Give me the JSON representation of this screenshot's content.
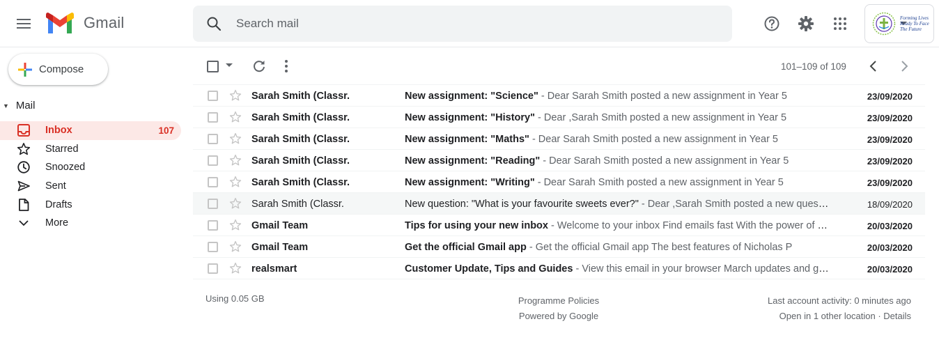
{
  "header": {
    "logo_text": "Gmail",
    "search_placeholder": "Search mail",
    "org_tagline": [
      "Forming Lives",
      "Ready To Face",
      "The Future"
    ]
  },
  "sidebar": {
    "compose_label": "Compose",
    "group_label": "Mail",
    "items": [
      {
        "label": "Inbox",
        "count": "107",
        "icon": "inbox-icon",
        "active": true
      },
      {
        "label": "Starred",
        "count": "",
        "icon": "star-icon",
        "active": false
      },
      {
        "label": "Snoozed",
        "count": "",
        "icon": "clock-icon",
        "active": false
      },
      {
        "label": "Sent",
        "count": "",
        "icon": "send-icon",
        "active": false
      },
      {
        "label": "Drafts",
        "count": "",
        "icon": "draft-icon",
        "active": false
      },
      {
        "label": "More",
        "count": "",
        "icon": "chevron-down-icon",
        "active": false
      }
    ]
  },
  "toolbar": {
    "pager_text": "101–109 of 109"
  },
  "messages": [
    {
      "sender": "Sarah Smith (Classr.",
      "subject": "New assignment: \"Science\"",
      "snippet": " - Dear          Sarah Smith posted a new assignment in Year 5",
      "date": "23/09/2020",
      "unread": true
    },
    {
      "sender": "Sarah Smith (Classr.",
      "subject": "New assignment: \"History\"",
      "snippet": " - Dear          ,Sarah Smith posted a new assignment in Year 5",
      "date": "23/09/2020",
      "unread": true
    },
    {
      "sender": "Sarah Smith (Classr.",
      "subject": "New assignment: \"Maths\"",
      "snippet": " - Dear          Sarah Smith posted a new assignment in Year 5",
      "date": "23/09/2020",
      "unread": true
    },
    {
      "sender": "Sarah Smith (Classr.",
      "subject": "New assignment: \"Reading\"",
      "snippet": " - Dear          Sarah Smith posted a new assignment in Year 5",
      "date": "23/09/2020",
      "unread": true
    },
    {
      "sender": "Sarah Smith (Classr.",
      "subject": "New assignment: \"Writing\"",
      "snippet": " - Dear          Sarah Smith posted a new assignment in Year 5",
      "date": "23/09/2020",
      "unread": true
    },
    {
      "sender": "Sarah Smith (Classr.",
      "subject": "New question: \"What is your favourite sweets ever?\"",
      "snippet": " - Dear          ,Sarah Smith posted a new question",
      "date": "18/09/2020",
      "unread": false
    },
    {
      "sender": "Gmail Team",
      "subject": "Tips for using your new inbox",
      "snippet": " - Welcome to your inbox Find emails fast With the power of Google Search",
      "date": "20/03/2020",
      "unread": true
    },
    {
      "sender": "Gmail Team",
      "subject": "Get the official Gmail app",
      "snippet": " - Get the official Gmail app The best features of Nicholas P",
      "date": "20/03/2020",
      "unread": true
    },
    {
      "sender": "realsmart",
      "subject": "Customer Update, Tips and Guides",
      "snippet": " - View this email in your browser March updates and guides",
      "date": "20/03/2020",
      "unread": true
    }
  ],
  "footer": {
    "storage": "Using 0.05 GB",
    "policies": "Programme Policies",
    "powered": "Powered by Google",
    "last_activity": "Last account activity: 0 minutes ago",
    "other_location": "Open in 1 other location · Details"
  },
  "colors": {
    "accent_red": "#d93025",
    "active_bg": "#fce8e6",
    "search_bg": "#f1f3f4"
  }
}
